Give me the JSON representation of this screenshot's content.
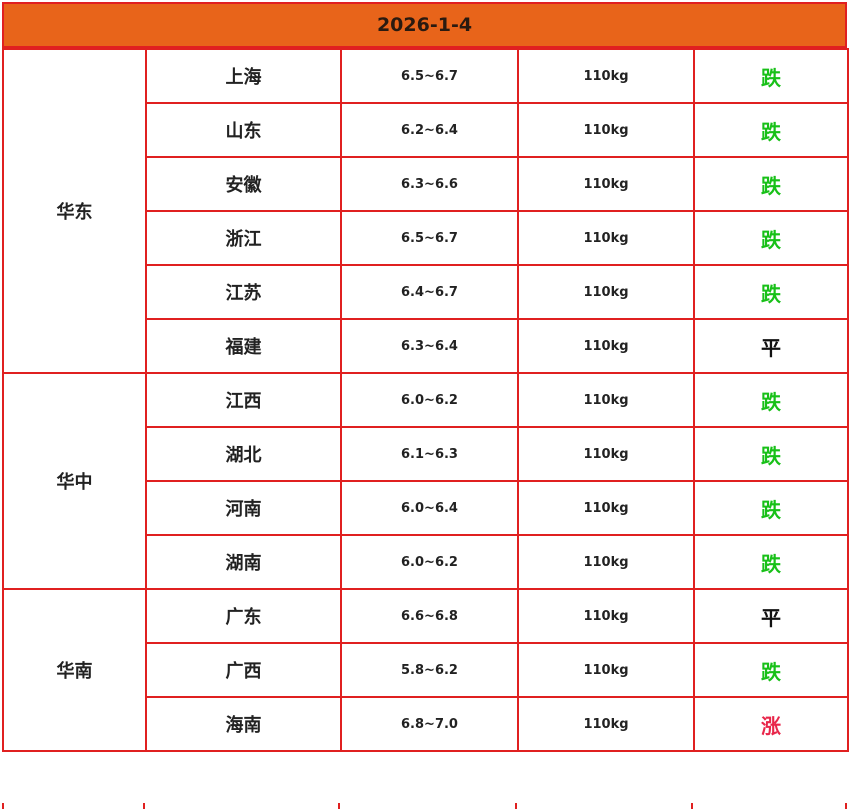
{
  "header": {
    "date": "2026-1-4"
  },
  "regions": [
    {
      "name": "华东",
      "rows": [
        {
          "province": "上海",
          "range": "6.5~6.7",
          "weight": "110kg",
          "trend": "跌",
          "trend_type": "down"
        },
        {
          "province": "山东",
          "range": "6.2~6.4",
          "weight": "110kg",
          "trend": "跌",
          "trend_type": "down"
        },
        {
          "province": "安徽",
          "range": "6.3~6.6",
          "weight": "110kg",
          "trend": "跌",
          "trend_type": "down"
        },
        {
          "province": "浙江",
          "range": "6.5~6.7",
          "weight": "110kg",
          "trend": "跌",
          "trend_type": "down"
        },
        {
          "province": "江苏",
          "range": "6.4~6.7",
          "weight": "110kg",
          "trend": "跌",
          "trend_type": "down"
        },
        {
          "province": "福建",
          "range": "6.3~6.4",
          "weight": "110kg",
          "trend": "平",
          "trend_type": "flat"
        }
      ]
    },
    {
      "name": "华中",
      "rows": [
        {
          "province": "江西",
          "range": "6.0~6.2",
          "weight": "110kg",
          "trend": "跌",
          "trend_type": "down"
        },
        {
          "province": "湖北",
          "range": "6.1~6.3",
          "weight": "110kg",
          "trend": "跌",
          "trend_type": "down"
        },
        {
          "province": "河南",
          "range": "6.0~6.4",
          "weight": "110kg",
          "trend": "跌",
          "trend_type": "down"
        },
        {
          "province": "湖南",
          "range": "6.0~6.2",
          "weight": "110kg",
          "trend": "跌",
          "trend_type": "down"
        }
      ]
    },
    {
      "name": "华南",
      "rows": [
        {
          "province": "广东",
          "range": "6.6~6.8",
          "weight": "110kg",
          "trend": "平",
          "trend_type": "flat"
        },
        {
          "province": "广西",
          "range": "5.8~6.2",
          "weight": "110kg",
          "trend": "跌",
          "trend_type": "down"
        },
        {
          "province": "海南",
          "range": "6.8~7.0",
          "weight": "110kg",
          "trend": "涨",
          "trend_type": "up"
        }
      ]
    }
  ],
  "colors": {
    "header_bg": "#e8641a",
    "border": "#e02020",
    "down": "#18c018",
    "flat": "#111111",
    "up": "#e8264a"
  }
}
